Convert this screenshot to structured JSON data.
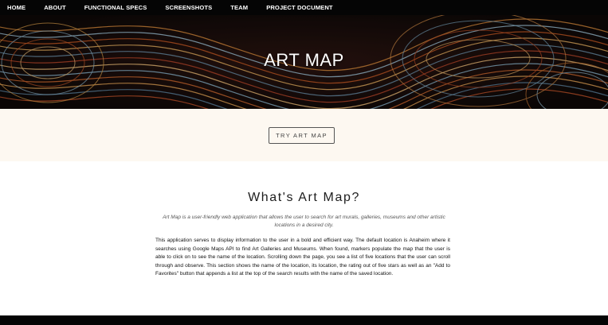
{
  "nav": {
    "items": [
      {
        "id": "home",
        "label": "HOME"
      },
      {
        "id": "about",
        "label": "ABOUT"
      },
      {
        "id": "functional-specs",
        "label": "FUNCTIONAL SPECS"
      },
      {
        "id": "screenshots",
        "label": "SCREENSHOTS"
      },
      {
        "id": "team",
        "label": "TEAM"
      },
      {
        "id": "project-document",
        "label": "PROJECT DOCUMENT"
      }
    ]
  },
  "hero": {
    "title": "ART MAP"
  },
  "cta": {
    "label": "TRY ART MAP"
  },
  "about": {
    "heading": "What's Art Map?",
    "lead_em": "Art Map",
    "lead_rest": " is a user-friendly web application that allows the user to search for art murals, galleries, museums and other artistic locations in a desired city.",
    "body": "This application serves to display information to the user in a bold and efficient way. The default location is Anaheim where it searches using Google Maps API to find Art Galleries and Museums. When found, markers populate the map that the user is able to click on to see the name of the location. Scrolling down the page, you see a list of five locations that the user can scroll through and observe. This section shows the name of the location, its location, the rating out of five stars as well as an \"Add to Favorites\" button that appends a list at the top of the search results with the name of the saved location."
  },
  "colors": {
    "nav_bg": "#050505",
    "cta_band_bg": "#fdf8f1",
    "cta_border": "#555555",
    "heading_text": "#1d1d1d"
  }
}
